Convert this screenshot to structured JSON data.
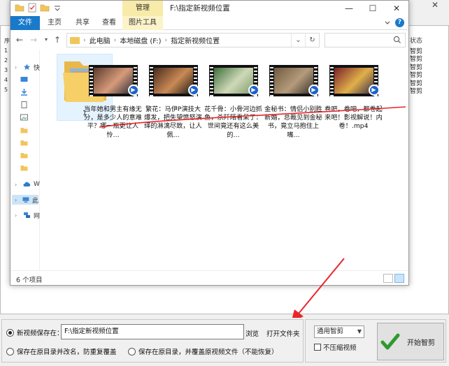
{
  "background_app": {
    "left_column_glyphs": [
      "序",
      "1",
      "2",
      "3",
      "4",
      "5"
    ],
    "status_header": "状态",
    "status_values": [
      "智剪",
      "智剪",
      "智剪",
      "智剪",
      "智剪",
      "智剪"
    ],
    "close_symbol": "✕"
  },
  "explorer": {
    "title": "F:\\指定新视频位置",
    "manage_tab": "管理",
    "ribbon_tabs": [
      "文件",
      "主页",
      "共享",
      "查看",
      "图片工具"
    ],
    "address": {
      "segments": [
        "此电脑",
        "本地磁盘 (F:)",
        "指定新视频位置"
      ]
    },
    "search_placeholder": "",
    "nav_items": [
      "快",
      "",
      "",
      "",
      "",
      "",
      "",
      "",
      "",
      "",
      "W",
      "此",
      "网"
    ],
    "folder": {
      "label": "1"
    },
    "videos": [
      {
        "caption": "当年她和男主有缘无分，是多少人的意难平？哪一瓶更让人怜…",
        "palette": [
          "#5a3b2e",
          "#d79b7a",
          "#2b2b3a"
        ]
      },
      {
        "caption": "繁花：马伊P演技大爆发，把失望愤怒演绎的淋漓尽致，让人佩…",
        "palette": [
          "#4a2b1e",
          "#c98a55",
          "#1d1a16"
        ]
      },
      {
        "caption": "花千骨：小骨河边抓鱼，杀阡陌看呆了：世间竟还有这么美的…",
        "palette": [
          "#3e6f3a",
          "#cfd9b8",
          "#7e9c6c"
        ]
      },
      {
        "caption": "金秘书：情侣小别胜新婚，总裁见到金秘书，竟立马抱住上嘴…",
        "palette": [
          "#6f5a3f",
          "#b59b7b",
          "#34302a"
        ]
      },
      {
        "caption": "卷吧，卷吧，都卷起来吧！影视解说！内卷！.mp4",
        "palette": [
          "#7a1f2a",
          "#e0b04a",
          "#3b2c4c"
        ]
      }
    ],
    "status_count": "6 个项目"
  },
  "bottom": {
    "save_new_label": "新视频保存在：",
    "path_value": "F:\\指定新视频位置",
    "browse_label": "浏览",
    "open_folder_label": "打开文件夹",
    "save_rename_label": "保存在原目录并改名，防重复覆盖",
    "save_overwrite_label": "保存在原目录，并覆盖原视频文件（不能恢复）",
    "mode_select": "通用智剪",
    "no_compress_label": "不压缩视频",
    "start_label": "开始智剪"
  },
  "colors": {
    "accent_blue": "#1979ca",
    "manage_tab_bg": "#f8eaa8",
    "annotation_red": "#e8262b"
  }
}
